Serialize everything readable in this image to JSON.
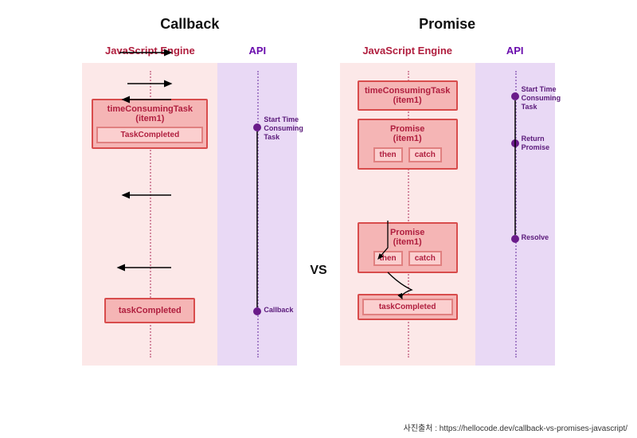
{
  "titles": {
    "callback": "Callback",
    "promise": "Promise",
    "engine": "JavaScript Engine",
    "api": "API",
    "vs": "VS"
  },
  "callback": {
    "box1_line1": "timeConsumingTask",
    "box1_line2": "(item1)",
    "box1_inner": "TaskCompleted",
    "box2": "taskCompleted",
    "api1_l1": "Start Time",
    "api1_l2": "Consuming",
    "api1_l3": "Task",
    "api2": "Callback"
  },
  "promise": {
    "box1_line1": "timeConsumingTask",
    "box1_line2": "(item1)",
    "box2_line1": "Promise",
    "box2_line2": "(item1)",
    "then": "then",
    "catch": "catch",
    "box3_line1": "Promise",
    "box3_line2": "(item1)",
    "box4": "taskCompleted",
    "api1_l1": "Start Time",
    "api1_l2": "Consuming",
    "api1_l3": "Task",
    "api2_l1": "Return",
    "api2_l2": "Promise",
    "api3": "Resolve"
  },
  "credit": "사진출처 : https://hellocode.dev/callback-vs-promises-javascript/"
}
